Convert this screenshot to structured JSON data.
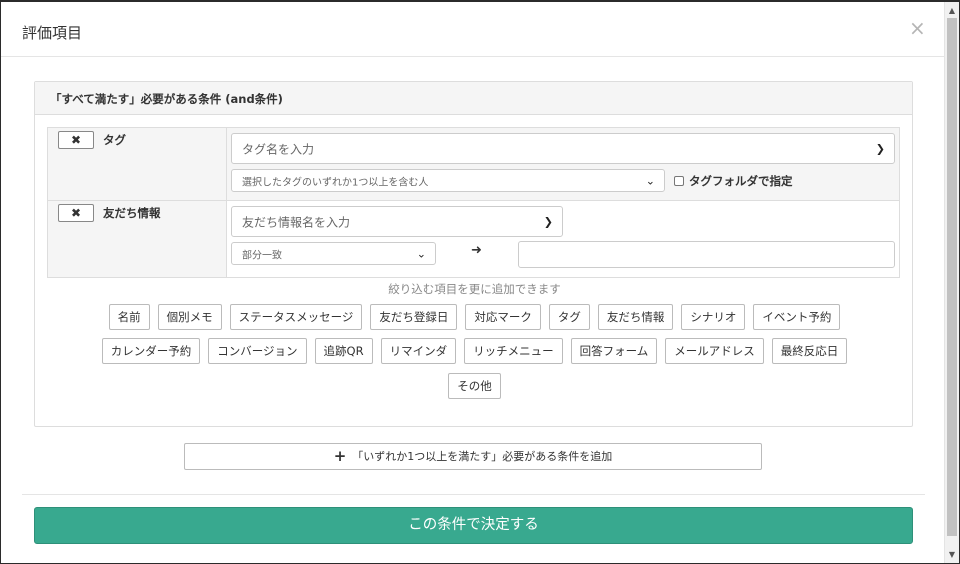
{
  "modal": {
    "title": "評価項目",
    "close": "×"
  },
  "panel": {
    "heading": "「すべて満たす」必要がある条件 (and条件)"
  },
  "conditions": {
    "tag": {
      "remove": "✖",
      "label": "タグ",
      "name_placeholder": "タグ名を入力",
      "match_mode": "選択したタグのいずれか1つ以上を含む人",
      "folder_checkbox_label": "タグフォルダで指定"
    },
    "friend": {
      "remove": "✖",
      "label": "友だち情報",
      "name_placeholder": "友だち情報名を入力",
      "match_mode": "部分一致",
      "arrow": "➜",
      "value": ""
    }
  },
  "hint": "絞り込む項目を更に追加できます",
  "chips": {
    "row1": [
      "名前",
      "個別メモ",
      "ステータスメッセージ",
      "友だち登録日",
      "対応マーク",
      "タグ",
      "友だち情報",
      "シナリオ",
      "イベント予約"
    ],
    "row2": [
      "カレンダー予約",
      "コンバージョン",
      "追跡QR",
      "リマインダ",
      "リッチメニュー",
      "回答フォーム",
      "メールアドレス",
      "最終反応日"
    ],
    "row3": [
      "その他"
    ]
  },
  "add_or_button": {
    "plus": "+",
    "label": "「いずれか1つ以上を満たす」必要がある条件を追加"
  },
  "submit": {
    "label": "この条件で決定する"
  },
  "icons": {
    "caret": "chevron-down-icon",
    "remove": "close-icon",
    "arrow": "arrow-right-icon",
    "plus": "plus-icon"
  },
  "colors": {
    "primary": "#38a98f"
  }
}
